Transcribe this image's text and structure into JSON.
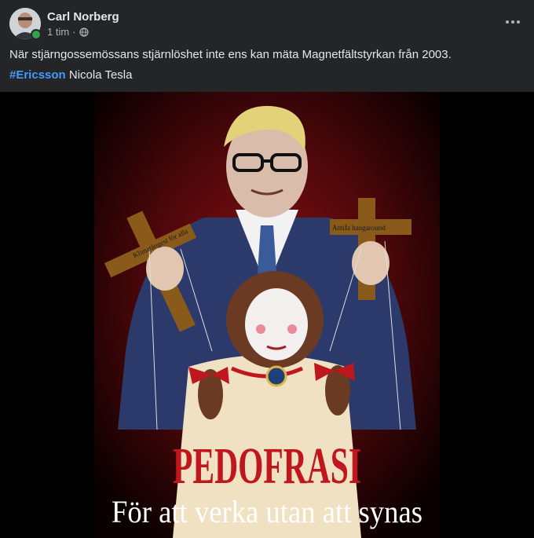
{
  "post": {
    "author": "Carl Norberg",
    "time": "1 tim",
    "separator": "·",
    "text": "När stjärngossemössans stjärnlöshet  inte ens kan mäta Magnetfältstyrkan från 2003.",
    "hashtag": "#Ericsson",
    "after_hashtag": " Nicola Tesla"
  },
  "poster": {
    "title": "PEDOFRASI",
    "subtitle": "För att verka utan att synas",
    "left_cross": "Klimatångest för alla",
    "right_cross": "Antifa hangaround"
  },
  "icons": {
    "privacy": "globe-icon",
    "more": "more-horizontal-icon"
  },
  "colors": {
    "background": "#242526",
    "hashtag": "#4599ff",
    "online": "#31a24c",
    "poster_title": "#c0161d"
  }
}
